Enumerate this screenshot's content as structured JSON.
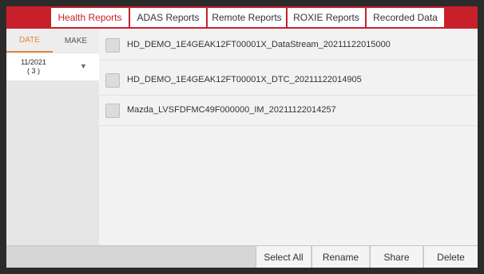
{
  "tabs": [
    {
      "label": "Health Reports",
      "active": true
    },
    {
      "label": "ADAS Reports",
      "active": false
    },
    {
      "label": "Remote Reports",
      "active": false
    },
    {
      "label": "ROXIE Reports",
      "active": false
    },
    {
      "label": "Recorded Data",
      "active": false
    }
  ],
  "filter": {
    "tabs": [
      {
        "label": "DATE",
        "active": true
      },
      {
        "label": "MAKE",
        "active": false
      }
    ],
    "groups": [
      {
        "month": "11/2021",
        "count": "( 3 )",
        "expanded": true
      }
    ]
  },
  "files": [
    {
      "name": "HD_DEMO_1E4GEAK12FT00001X_DataStream_20211122015000",
      "checked": false
    },
    {
      "name": "HD_DEMO_1E4GEAK12FT00001X_DTC_20211122014905",
      "checked": false
    },
    {
      "name": "Mazda_LVSFDFMC49F000000_IM_20211122014257",
      "checked": false
    }
  ],
  "toolbar": {
    "select_all": "Select All",
    "rename": "Rename",
    "share": "Share",
    "delete": "Delete"
  },
  "colors": {
    "accent_red": "#c8202b",
    "date_tab_orange": "#e8863a"
  },
  "icons": {
    "expand_arrow": "▼"
  }
}
